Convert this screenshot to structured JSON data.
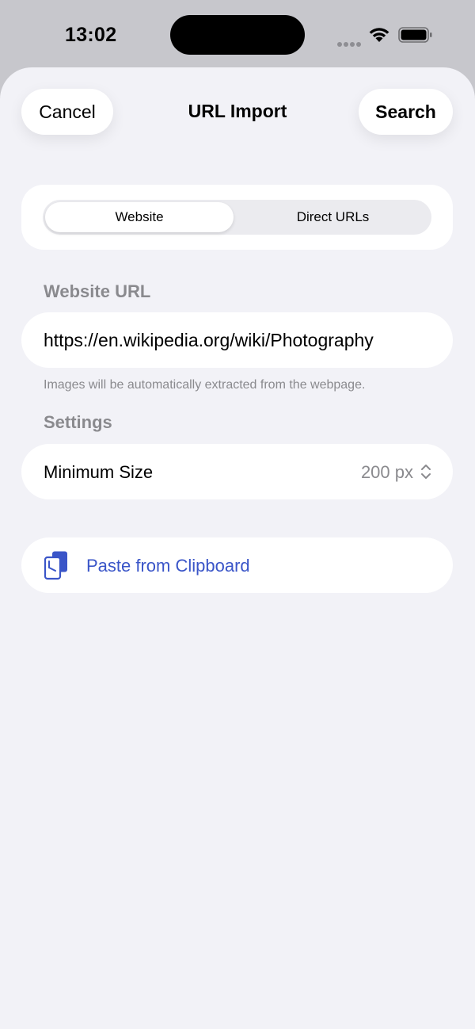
{
  "status_bar": {
    "time": "13:02"
  },
  "nav": {
    "cancel_label": "Cancel",
    "title": "URL Import",
    "search_label": "Search"
  },
  "segments": {
    "items": [
      {
        "label": "Website",
        "selected": true
      },
      {
        "label": "Direct URLs",
        "selected": false
      }
    ]
  },
  "website_url": {
    "header": "Website URL",
    "value": "https://en.wikipedia.org/wiki/Photography",
    "helper": "Images will be automatically extracted from the webpage."
  },
  "settings": {
    "header": "Settings",
    "minimum_size_label": "Minimum Size",
    "minimum_size_value": "200 px"
  },
  "paste": {
    "label": "Paste from Clipboard"
  },
  "icons": {
    "signal": "cellular-signal-icon",
    "wifi": "wifi-icon",
    "battery": "battery-icon",
    "stepper": "chevron-up-down-icon",
    "clipboard": "clipboard-paste-icon"
  },
  "colors": {
    "background": "#f2f2f7",
    "card": "#ffffff",
    "accent": "#3a55c8",
    "secondary_text": "#8a8a8e"
  }
}
